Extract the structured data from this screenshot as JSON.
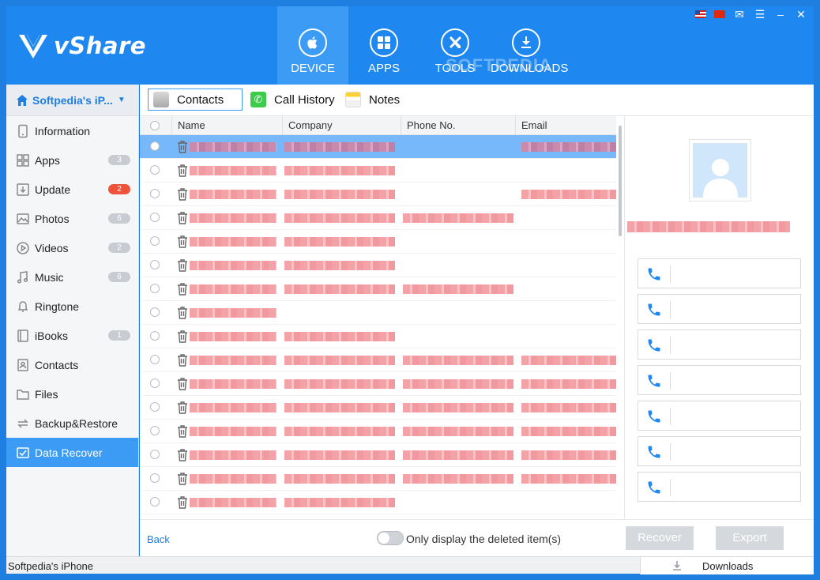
{
  "app": {
    "brand": "vShare",
    "watermark": "SOFTPEDIA",
    "colors": {
      "primary": "#1e88f0",
      "active_tab": "#3c9cf5",
      "selected_row": "#77b8fb",
      "badge_red": "#f0533b"
    }
  },
  "nav": {
    "tabs": [
      {
        "label": "DEVICE",
        "icon": "apple-icon",
        "active": true
      },
      {
        "label": "APPS",
        "icon": "grid-icon",
        "active": false
      },
      {
        "label": "TOOLS",
        "icon": "tools-icon",
        "active": false
      },
      {
        "label": "DOWNLOADS",
        "icon": "download-icon",
        "active": false
      }
    ]
  },
  "window_controls": [
    "us-flag-icon",
    "cn-flag-icon",
    "chat-icon",
    "menu-icon",
    "minimize-icon",
    "close-icon"
  ],
  "sidebar": {
    "device_name": "Softpedia's iP...",
    "items": [
      {
        "label": "Information",
        "icon": "phone-icon",
        "badge": ""
      },
      {
        "label": "Apps",
        "icon": "apps-icon",
        "badge": "3"
      },
      {
        "label": "Update",
        "icon": "update-icon",
        "badge": "2"
      },
      {
        "label": "Photos",
        "icon": "photo-icon",
        "badge": "6"
      },
      {
        "label": "Videos",
        "icon": "video-icon",
        "badge": "2"
      },
      {
        "label": "Music",
        "icon": "music-icon",
        "badge": "6"
      },
      {
        "label": "Ringtone",
        "icon": "bell-icon",
        "badge": ""
      },
      {
        "label": "iBooks",
        "icon": "book-icon",
        "badge": "1"
      },
      {
        "label": "Contacts",
        "icon": "contacts-icon",
        "badge": ""
      },
      {
        "label": "Files",
        "icon": "folder-icon",
        "badge": ""
      },
      {
        "label": "Backup&Restore",
        "icon": "backup-icon",
        "badge": ""
      },
      {
        "label": "Data Recover",
        "icon": "recover-icon",
        "badge": "",
        "active": true
      }
    ]
  },
  "subtabs": [
    {
      "label": "Contacts",
      "active": true
    },
    {
      "label": "Call History",
      "active": false
    },
    {
      "label": "Notes",
      "active": false
    }
  ],
  "table": {
    "columns": [
      "Name",
      "Company",
      "Phone No.",
      "Email"
    ],
    "rows": [
      {
        "selected": true,
        "name": "██████████",
        "company": "████████████",
        "phone": "",
        "email": "████████████"
      },
      {
        "selected": false,
        "name": "██████████",
        "company": "████████████",
        "phone": "",
        "email": ""
      },
      {
        "selected": false,
        "name": "██████████",
        "company": "██████",
        "phone": "",
        "email": "████████████"
      },
      {
        "selected": false,
        "name": "██████████",
        "company": "████",
        "phone": "████████████",
        "email": ""
      },
      {
        "selected": false,
        "name": "██",
        "company": "████████████",
        "phone": "",
        "email": ""
      },
      {
        "selected": false,
        "name": "██████████",
        "company": "████████████",
        "phone": "",
        "email": ""
      },
      {
        "selected": false,
        "name": "████████",
        "company": "████",
        "phone": "████████████",
        "email": ""
      },
      {
        "selected": false,
        "name": "█████████",
        "company": "",
        "phone": "",
        "email": ""
      },
      {
        "selected": false,
        "name": "████████",
        "company": "██████",
        "phone": "",
        "email": ""
      },
      {
        "selected": false,
        "name": "██████████",
        "company": "████████████",
        "phone": "████████████",
        "email": "████████████"
      },
      {
        "selected": false,
        "name": "██████████",
        "company": "██████",
        "phone": "████████████",
        "email": "████████████"
      },
      {
        "selected": false,
        "name": "██████████",
        "company": "████████████",
        "phone": "████████████",
        "email": "████████████"
      },
      {
        "selected": false,
        "name": "██████████",
        "company": "████████████",
        "phone": "████████████",
        "email": "████████████"
      },
      {
        "selected": false,
        "name": "██████████",
        "company": "████████████",
        "phone": "████████████",
        "email": "████████████"
      },
      {
        "selected": false,
        "name": "██████████",
        "company": "████████████",
        "phone": "██████",
        "email": "████████████"
      },
      {
        "selected": false,
        "name": "█████████",
        "company": "████████",
        "phone": "",
        "email": ""
      }
    ]
  },
  "detail": {
    "contact_name": "████████████████████...",
    "phone_fields": [
      "",
      "",
      "",
      "",
      "",
      "",
      ""
    ]
  },
  "footer": {
    "back_label": "Back",
    "toggle_label": "Only display the deleted item(s)",
    "recover_label": "Recover",
    "export_label": "Export"
  },
  "statusbar": {
    "device": "Softpedia's iPhone",
    "downloads_label": "Downloads"
  }
}
